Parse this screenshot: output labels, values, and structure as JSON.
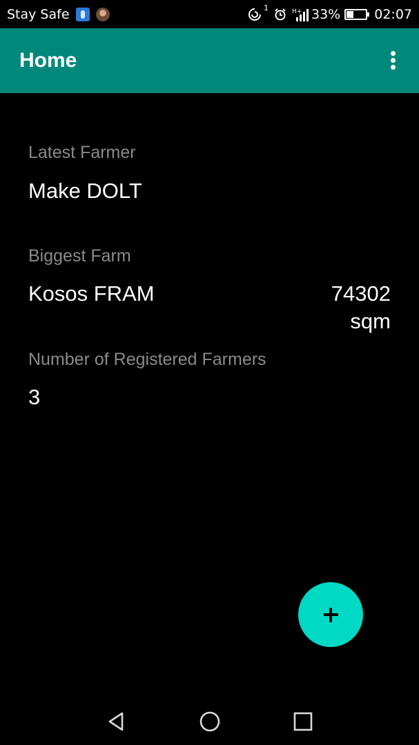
{
  "status_bar": {
    "carrier_text": "Stay Safe",
    "sync_count": "1",
    "network_type": "H+",
    "battery_percent": "33%",
    "battery_level": 0.33,
    "time": "02:07",
    "icons": [
      "usb-icon",
      "avatar",
      "sync-icon",
      "alarm-icon",
      "signal-icon",
      "battery-icon"
    ]
  },
  "app_bar": {
    "title": "Home",
    "menu_icon": "more-vert-icon"
  },
  "main": {
    "latest_farmer": {
      "label": "Latest Farmer",
      "value": "Make DOLT"
    },
    "biggest_farm": {
      "label": "Biggest Farm",
      "name": "Kosos FRAM",
      "size_number": "74302",
      "size_unit": "sqm"
    },
    "registered_farmers": {
      "label": "Number of Registered Farmers",
      "count": "3"
    }
  },
  "fab": {
    "icon": "plus-icon",
    "color": "#00d9c4"
  },
  "nav_bar": {
    "icons": [
      "back-icon",
      "home-icon",
      "recents-icon"
    ]
  },
  "colors": {
    "primary": "#00897b",
    "accent": "#00d9c4",
    "background": "#000000",
    "label": "#8a8a8a",
    "text": "#ffffff"
  }
}
